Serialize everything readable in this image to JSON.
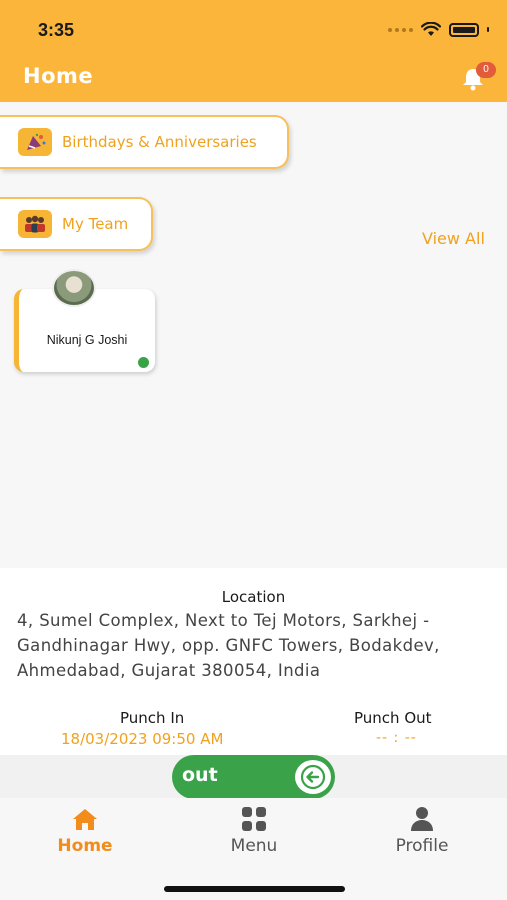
{
  "status_bar": {
    "time": "3:35"
  },
  "header": {
    "title": "Home",
    "notification_count": "0"
  },
  "sections": {
    "birthdays_label": "Birthdays & Anniversaries",
    "team_label": "My Team",
    "view_all": "View All"
  },
  "team_members": [
    {
      "name": "Nikunj G Joshi",
      "status": "online"
    }
  ],
  "location": {
    "title": "Location",
    "address": "4, Sumel Complex, Next to Tej Motors, Sarkhej - Gandhinagar Hwy, opp. GNFC Towers, Bodakdev, Ahmedabad, Gujarat 380054, India"
  },
  "punch": {
    "in_label": "Punch In",
    "in_value": "18/03/2023 09:50 AM",
    "out_label": "Punch Out",
    "out_value": "-- : --"
  },
  "slider": {
    "label": "out",
    "icon": "arrow-left-icon"
  },
  "tabs": [
    {
      "label": "Home",
      "icon": "home-icon",
      "active": true
    },
    {
      "label": "Menu",
      "icon": "grid-icon",
      "active": false
    },
    {
      "label": "Profile",
      "icon": "person-icon",
      "active": false
    }
  ],
  "colors": {
    "accent": "#fbb53a",
    "accent_text": "#f0a21f",
    "online": "#3aa34a",
    "badge": "#e25b3a",
    "inactive_tab": "#555555"
  }
}
